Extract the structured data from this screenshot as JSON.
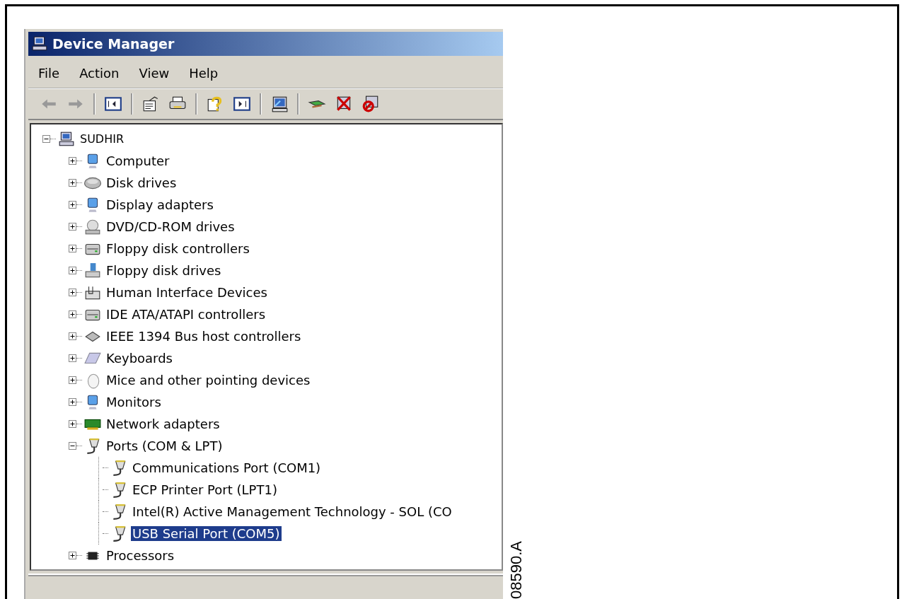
{
  "window": {
    "title": "Device Manager"
  },
  "menu": [
    {
      "label": "File"
    },
    {
      "label": "Action"
    },
    {
      "label": "View"
    },
    {
      "label": "Help"
    }
  ],
  "toolbar": [
    {
      "kind": "back",
      "disabled": true
    },
    {
      "kind": "forward",
      "disabled": true
    },
    {
      "kind": "separator"
    },
    {
      "kind": "tree-pane"
    },
    {
      "kind": "separator"
    },
    {
      "kind": "properties"
    },
    {
      "kind": "print"
    },
    {
      "kind": "separator"
    },
    {
      "kind": "help"
    },
    {
      "kind": "action-pane"
    },
    {
      "kind": "separator"
    },
    {
      "kind": "scan"
    },
    {
      "kind": "separator"
    },
    {
      "kind": "update"
    },
    {
      "kind": "uninstall"
    },
    {
      "kind": "disable"
    }
  ],
  "tree": {
    "label": "SUDHIR",
    "kind": "computer",
    "expanded": true,
    "selected": false,
    "children": [
      {
        "label": "Computer",
        "kind": "pc",
        "expanded": false,
        "selected": false
      },
      {
        "label": "Disk drives",
        "kind": "disk",
        "expanded": false,
        "selected": false
      },
      {
        "label": "Display adapters",
        "kind": "monitor",
        "expanded": false,
        "selected": false
      },
      {
        "label": "DVD/CD-ROM drives",
        "kind": "dvd",
        "expanded": false,
        "selected": false
      },
      {
        "label": "Floppy disk controllers",
        "kind": "controller",
        "expanded": false,
        "selected": false
      },
      {
        "label": "Floppy disk drives",
        "kind": "floppy",
        "expanded": false,
        "selected": false
      },
      {
        "label": "Human Interface Devices",
        "kind": "hid",
        "expanded": false,
        "selected": false
      },
      {
        "label": "IDE ATA/ATAPI controllers",
        "kind": "controller",
        "expanded": false,
        "selected": false
      },
      {
        "label": "IEEE 1394 Bus host controllers",
        "kind": "bus",
        "expanded": false,
        "selected": false
      },
      {
        "label": "Keyboards",
        "kind": "keyboard",
        "expanded": false,
        "selected": false
      },
      {
        "label": "Mice and other pointing devices",
        "kind": "mouse",
        "expanded": false,
        "selected": false
      },
      {
        "label": "Monitors",
        "kind": "monitor",
        "expanded": false,
        "selected": false
      },
      {
        "label": "Network adapters",
        "kind": "network",
        "expanded": false,
        "selected": false
      },
      {
        "label": "Ports (COM & LPT)",
        "kind": "port",
        "expanded": true,
        "selected": false,
        "children": [
          {
            "label": "Communications Port (COM1)",
            "kind": "port",
            "selected": false
          },
          {
            "label": "ECP Printer Port (LPT1)",
            "kind": "port",
            "selected": false
          },
          {
            "label": "Intel(R) Active Management Technology - SOL (CO",
            "kind": "port",
            "selected": false
          },
          {
            "label": "USB Serial Port (COM5)",
            "kind": "port",
            "selected": true
          }
        ]
      },
      {
        "label": "Processors",
        "kind": "chip",
        "expanded": false,
        "selected": false
      }
    ]
  },
  "figure_label": "08590.A"
}
